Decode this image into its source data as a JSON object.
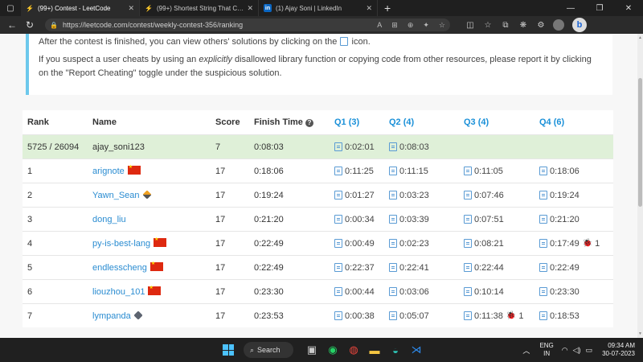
{
  "browser": {
    "tabs": [
      {
        "title": "(99+) Contest - LeetCode",
        "icon": "leetcode-icon",
        "active": true
      },
      {
        "title": "(99+) Shortest String That Contains Three Strings",
        "icon": "leetcode-icon",
        "active": false
      },
      {
        "title": "(1) Ajay Soni | LinkedIn",
        "icon": "linkedin-icon",
        "active": false
      }
    ],
    "url": "https://leetcode.com/contest/weekly-contest-356/ranking"
  },
  "info": {
    "line1_pre": "After the contest is finished, you can view others' solutions by clicking on the",
    "line1_post": "icon.",
    "line2_pre": "If you suspect a user cheats by using an",
    "line2_em": "explicitly",
    "line2_post": "disallowed library function or copying code from other resources, please report it by clicking on the \"Report Cheating\" toggle under the suspicious solution."
  },
  "table": {
    "headers": {
      "rank": "Rank",
      "name": "Name",
      "score": "Score",
      "finish": "Finish Time",
      "q1": "Q1 (3)",
      "q2": "Q2 (4)",
      "q3": "Q3 (4)",
      "q4": "Q4 (6)"
    },
    "rows": [
      {
        "rank": "5725 / 26094",
        "name": "ajay_soni123",
        "score": "7",
        "finish": "0:08:03",
        "q1": "0:02:01",
        "q2": "0:08:03",
        "q3": "",
        "q4": ""
      },
      {
        "rank": "1",
        "name": "arignote",
        "score": "17",
        "finish": "0:18:06",
        "q1": "0:11:25",
        "q2": "0:11:15",
        "q3": "0:11:05",
        "q4": "0:18:06"
      },
      {
        "rank": "2",
        "name": "Yawn_Sean",
        "score": "17",
        "finish": "0:19:24",
        "q1": "0:01:27",
        "q2": "0:03:23",
        "q3": "0:07:46",
        "q4": "0:19:24"
      },
      {
        "rank": "3",
        "name": "dong_liu",
        "score": "17",
        "finish": "0:21:20",
        "q1": "0:00:34",
        "q2": "0:03:39",
        "q3": "0:07:51",
        "q4": "0:21:20"
      },
      {
        "rank": "4",
        "name": "py-is-best-lang",
        "score": "17",
        "finish": "0:22:49",
        "q1": "0:00:49",
        "q2": "0:02:23",
        "q3": "0:08:21",
        "q4": "0:17:49",
        "q4_bug": "1"
      },
      {
        "rank": "5",
        "name": "endlesscheng",
        "score": "17",
        "finish": "0:22:49",
        "q1": "0:22:37",
        "q2": "0:22:41",
        "q3": "0:22:44",
        "q4": "0:22:49"
      },
      {
        "rank": "6",
        "name": "liouzhou_101",
        "score": "17",
        "finish": "0:23:30",
        "q1": "0:00:44",
        "q2": "0:03:06",
        "q3": "0:10:14",
        "q4": "0:23:30"
      },
      {
        "rank": "7",
        "name": "lympanda",
        "score": "17",
        "finish": "0:23:53",
        "q1": "0:00:38",
        "q2": "0:05:07",
        "q3": "0:11:38",
        "q3_bug": "1",
        "q4": "0:18:53"
      }
    ]
  },
  "taskbar": {
    "search_label": "Search",
    "lang_top": "ENG",
    "lang_bottom": "IN",
    "time": "09:34 AM",
    "date": "30-07-2023"
  },
  "colors": {
    "accent": "#1a90d8",
    "highlight_row": "#dff0d8",
    "info_border": "#6dc8ec"
  }
}
